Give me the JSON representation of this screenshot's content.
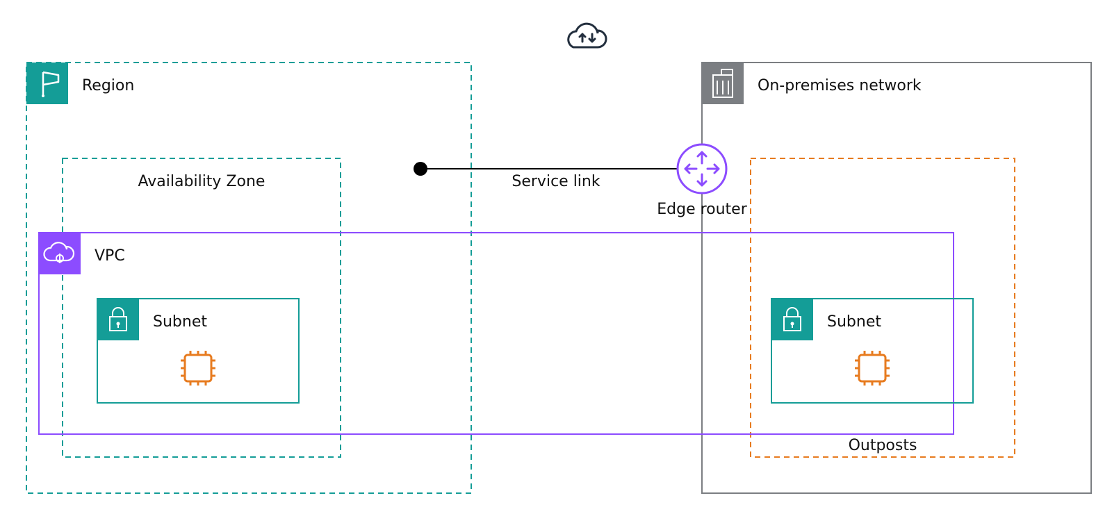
{
  "labels": {
    "cloud": "",
    "region": "Region",
    "az": "Availability Zone",
    "vpc": "VPC",
    "subnet_left": "Subnet",
    "subnet_right": "Subnet",
    "onprem": "On-premises network",
    "edge_router": "Edge router",
    "service_link": "Service link",
    "outposts": "Outposts"
  },
  "colors": {
    "teal": "#149d97",
    "purple": "#8c4cff",
    "orange": "#e77b1f",
    "gray": "#7b7e82",
    "dark": "#232f3e"
  }
}
